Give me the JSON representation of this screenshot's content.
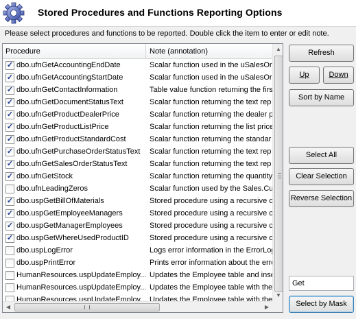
{
  "header": {
    "title": "Stored Procedures and Functions Reporting Options",
    "icon": "gear-icon"
  },
  "instruction": "Please select procedures and functions to be reported. Double click the item to enter or edit note.",
  "table": {
    "columns": [
      "Procedure",
      "Note (annotation)"
    ],
    "rows": [
      {
        "checked": true,
        "procedure": "dbo.ufnGetAccountingEndDate",
        "note": "Scalar function used in the uSalesOr"
      },
      {
        "checked": true,
        "procedure": "dbo.ufnGetAccountingStartDate",
        "note": "Scalar function used in the uSalesOr"
      },
      {
        "checked": true,
        "procedure": "dbo.ufnGetContactInformation",
        "note": "Table value function returning the firs"
      },
      {
        "checked": true,
        "procedure": "dbo.ufnGetDocumentStatusText",
        "note": "Scalar function returning the text rep"
      },
      {
        "checked": true,
        "procedure": "dbo.ufnGetProductDealerPrice",
        "note": "Scalar function returning the dealer p"
      },
      {
        "checked": true,
        "procedure": "dbo.ufnGetProductListPrice",
        "note": "Scalar function returning the list price"
      },
      {
        "checked": true,
        "procedure": "dbo.ufnGetProductStandardCost",
        "note": "Scalar function returning the standar"
      },
      {
        "checked": true,
        "procedure": "dbo.ufnGetPurchaseOrderStatusText",
        "note": "Scalar function returning the text rep"
      },
      {
        "checked": true,
        "procedure": "dbo.ufnGetSalesOrderStatusText",
        "note": "Scalar function returning the text rep"
      },
      {
        "checked": true,
        "procedure": "dbo.ufnGetStock",
        "note": "Scalar function returning the quantity"
      },
      {
        "checked": false,
        "procedure": "dbo.ufnLeadingZeros",
        "note": "Scalar function used by the Sales.Cu"
      },
      {
        "checked": true,
        "procedure": "dbo.uspGetBillOfMaterials",
        "note": "Stored procedure using a recursive c"
      },
      {
        "checked": true,
        "procedure": "dbo.uspGetEmployeeManagers",
        "note": "Stored procedure using a recursive c"
      },
      {
        "checked": true,
        "procedure": "dbo.uspGetManagerEmployees",
        "note": "Stored procedure using a recursive c"
      },
      {
        "checked": true,
        "procedure": "dbo.uspGetWhereUsedProductID",
        "note": "Stored procedure using a recursive c"
      },
      {
        "checked": false,
        "procedure": "dbo.uspLogError",
        "note": "Logs error information in the ErrorLog"
      },
      {
        "checked": false,
        "procedure": "dbo.uspPrintError",
        "note": "Prints error information about the erro"
      },
      {
        "checked": false,
        "procedure": "HumanResources.uspUpdateEmploy...",
        "note": "Updates the Employee table and inse"
      },
      {
        "checked": false,
        "procedure": "HumanResources.uspUpdateEmploy...",
        "note": "Updates the Employee table with the"
      },
      {
        "checked": false,
        "procedure": "HumanResources.uspUpdateEmploy...",
        "note": "Updates the Employee table with the"
      }
    ]
  },
  "buttons": {
    "refresh": "Refresh",
    "up": "Up",
    "down": "Down",
    "sort_by_name": "Sort by Name",
    "select_all": "Select All",
    "clear_selection": "Clear Selection",
    "reverse_selection": "Reverse Selection",
    "select_by_mask": "Select by Mask"
  },
  "mask": {
    "value": "Get"
  },
  "colors": {
    "check": "#1f3b8c",
    "focus_border": "#3c7fb1"
  }
}
